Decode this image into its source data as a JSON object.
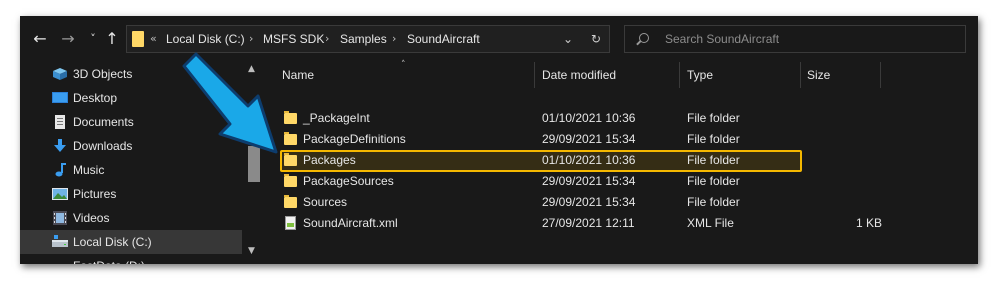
{
  "nav": {
    "back": "←",
    "forward": "→",
    "recent": "˅",
    "up": "↑"
  },
  "address": {
    "overflow": "«",
    "breadcrumbs": [
      "Local Disk (C:)",
      "MSFS SDK",
      "Samples",
      "SoundAircraft"
    ],
    "separator": "›",
    "dropdown": "⌄",
    "refresh": "↻"
  },
  "search": {
    "placeholder": "Search SoundAircraft"
  },
  "sidebar": {
    "items": [
      {
        "label": "3D Objects",
        "icon": "3d-objects-icon"
      },
      {
        "label": "Desktop",
        "icon": "desktop-icon"
      },
      {
        "label": "Documents",
        "icon": "documents-icon"
      },
      {
        "label": "Downloads",
        "icon": "downloads-icon"
      },
      {
        "label": "Music",
        "icon": "music-icon"
      },
      {
        "label": "Pictures",
        "icon": "pictures-icon"
      },
      {
        "label": "Videos",
        "icon": "videos-icon"
      },
      {
        "label": "Local Disk (C:)",
        "icon": "drive-icon",
        "selected": true
      },
      {
        "label": "FastData (D:)",
        "icon": "drive-icon"
      }
    ]
  },
  "columns": [
    "Name",
    "Date modified",
    "Type",
    "Size"
  ],
  "files": [
    {
      "name": "_PackageInt",
      "date": "01/10/2021 10:36",
      "type": "File folder",
      "size": ""
    },
    {
      "name": "PackageDefinitions",
      "date": "29/09/2021 15:34",
      "type": "File folder",
      "size": ""
    },
    {
      "name": "Packages",
      "date": "01/10/2021 10:36",
      "type": "File folder",
      "size": "",
      "highlighted": true
    },
    {
      "name": "PackageSources",
      "date": "29/09/2021 15:34",
      "type": "File folder",
      "size": ""
    },
    {
      "name": "Sources",
      "date": "29/09/2021 15:34",
      "type": "File folder",
      "size": ""
    },
    {
      "name": "SoundAircraft.xml",
      "date": "27/09/2021 12:11",
      "type": "XML File",
      "size": "1 KB"
    }
  ],
  "colors": {
    "background": "#191919",
    "highlight_border": "#f5b800",
    "arrow": "#1aa8e8",
    "folder": "#ffd867"
  }
}
